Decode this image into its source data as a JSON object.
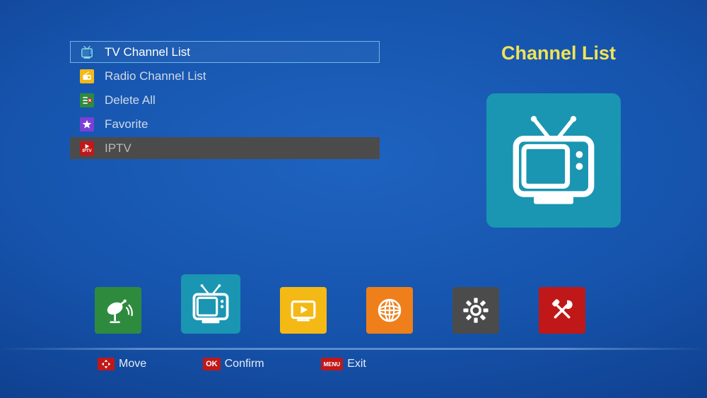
{
  "panel_title": "Channel List",
  "menu": [
    {
      "key": "tv",
      "label": "TV Channel List",
      "selected": true,
      "dim": false
    },
    {
      "key": "radio",
      "label": "Radio Channel List",
      "selected": false,
      "dim": false
    },
    {
      "key": "delete",
      "label": "Delete All",
      "selected": false,
      "dim": false
    },
    {
      "key": "favorite",
      "label": "Favorite",
      "selected": false,
      "dim": false
    },
    {
      "key": "iptv",
      "label": "IPTV",
      "selected": false,
      "dim": true
    }
  ],
  "tabs": {
    "selected_index": 1,
    "items": [
      "satellite",
      "channel",
      "media",
      "network",
      "settings",
      "tools"
    ]
  },
  "hints": {
    "move": {
      "key_label": "",
      "text": "Move"
    },
    "confirm": {
      "key_label": "OK",
      "text": "Confirm"
    },
    "exit": {
      "key_label": "MENU",
      "text": "Exit"
    }
  },
  "iptv_key_text": "IPTV"
}
